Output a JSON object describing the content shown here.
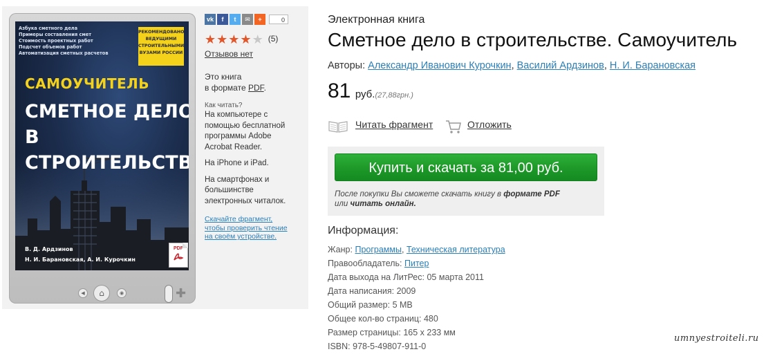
{
  "reader": {
    "cover_list": [
      "Азбука сметного дела",
      "Примеры составления смет",
      "Стоимость проектных работ",
      "Подсчет объемов работ",
      "Автоматизация сметных расчетов"
    ],
    "cover_badge": [
      "РЕКОМЕНДОВАНО",
      "ВЕДУЩИМИ",
      "СТРОИТЕЛЬНЫМИ",
      "ВУЗАМИ РОССИИ"
    ],
    "cover_series": "САМОУЧИТЕЛЬ",
    "cover_title_1": "СМЕТНОЕ ДЕЛО",
    "cover_title_2": "В СТРОИТЕЛЬСТВЕ",
    "cover_author_1": "В. Д. Ардзинов",
    "cover_author_2": "Н. И. Барановская, А. И. Курочкин",
    "pdf_label": "PDF"
  },
  "share": {
    "buttons": [
      {
        "label": "vk",
        "color": "#4c75a3"
      },
      {
        "label": "f",
        "color": "#3b5998"
      },
      {
        "label": "t",
        "color": "#55acee"
      },
      {
        "label": "✉",
        "color": "#8a8a8a"
      },
      {
        "label": "+",
        "color": "#f26522"
      }
    ],
    "count": "0"
  },
  "rating": {
    "stars_filled": 4,
    "stars_total": 5,
    "count": "(5)"
  },
  "reviews_label": "Отзывов нет",
  "format": {
    "line1": "Это книга",
    "line2_prefix": "в формате ",
    "line2_link": "PDF",
    "line2_suffix": "."
  },
  "howto": {
    "title": "Как читать?",
    "items": [
      "На компьютере с помощью бесплатной программы Adobe Acrobat Reader.",
      "На iPhone и iPad.",
      "На смартфонах и большинстве электронных читалок."
    ],
    "download_note": "Скачайте фрагмент, чтобы проверить чтение на своём устройстве."
  },
  "book": {
    "kind": "Электронная книга",
    "title": "Сметное дело в строительстве. Самоучитель",
    "authors_label": "Авторы:",
    "authors": [
      "Александр Иванович Курочкин",
      "Василий Ардзинов",
      "Н. И. Барановская"
    ],
    "price": "81",
    "currency": "руб.",
    "price_alt": "(27,88грн.)"
  },
  "actions": {
    "read_fragment": "Читать фрагмент",
    "postpone": "Отложить"
  },
  "buy": {
    "button": "Купить и скачать за 81,00 руб.",
    "note_1": "После покупки Вы сможете скачать книгу в ",
    "note_bold_1": "формате PDF",
    "note_2": "или ",
    "note_bold_2": "читать онлайн."
  },
  "info": {
    "title": "Информация:",
    "genre_label": "Жанр:",
    "genres": [
      "Программы",
      "Техническая литература"
    ],
    "rights_label": "Правообладатель:",
    "rights_value": "Питер",
    "release_label": "Дата выхода на ЛитРес:",
    "release_value": "05 марта 2011",
    "written_label": "Дата написания:",
    "written_value": "2009",
    "size_label": "Общий размер:",
    "size_value": "5 MB",
    "pages_label": "Общее кол-во страниц:",
    "pages_value": "480",
    "page_size_label": "Размер страницы:",
    "page_size_value": "165 x 233 мм",
    "isbn_label": "ISBN:",
    "isbn_value": "978-5-49807-911-0"
  },
  "watermark": "umnyestroiteli.ru"
}
